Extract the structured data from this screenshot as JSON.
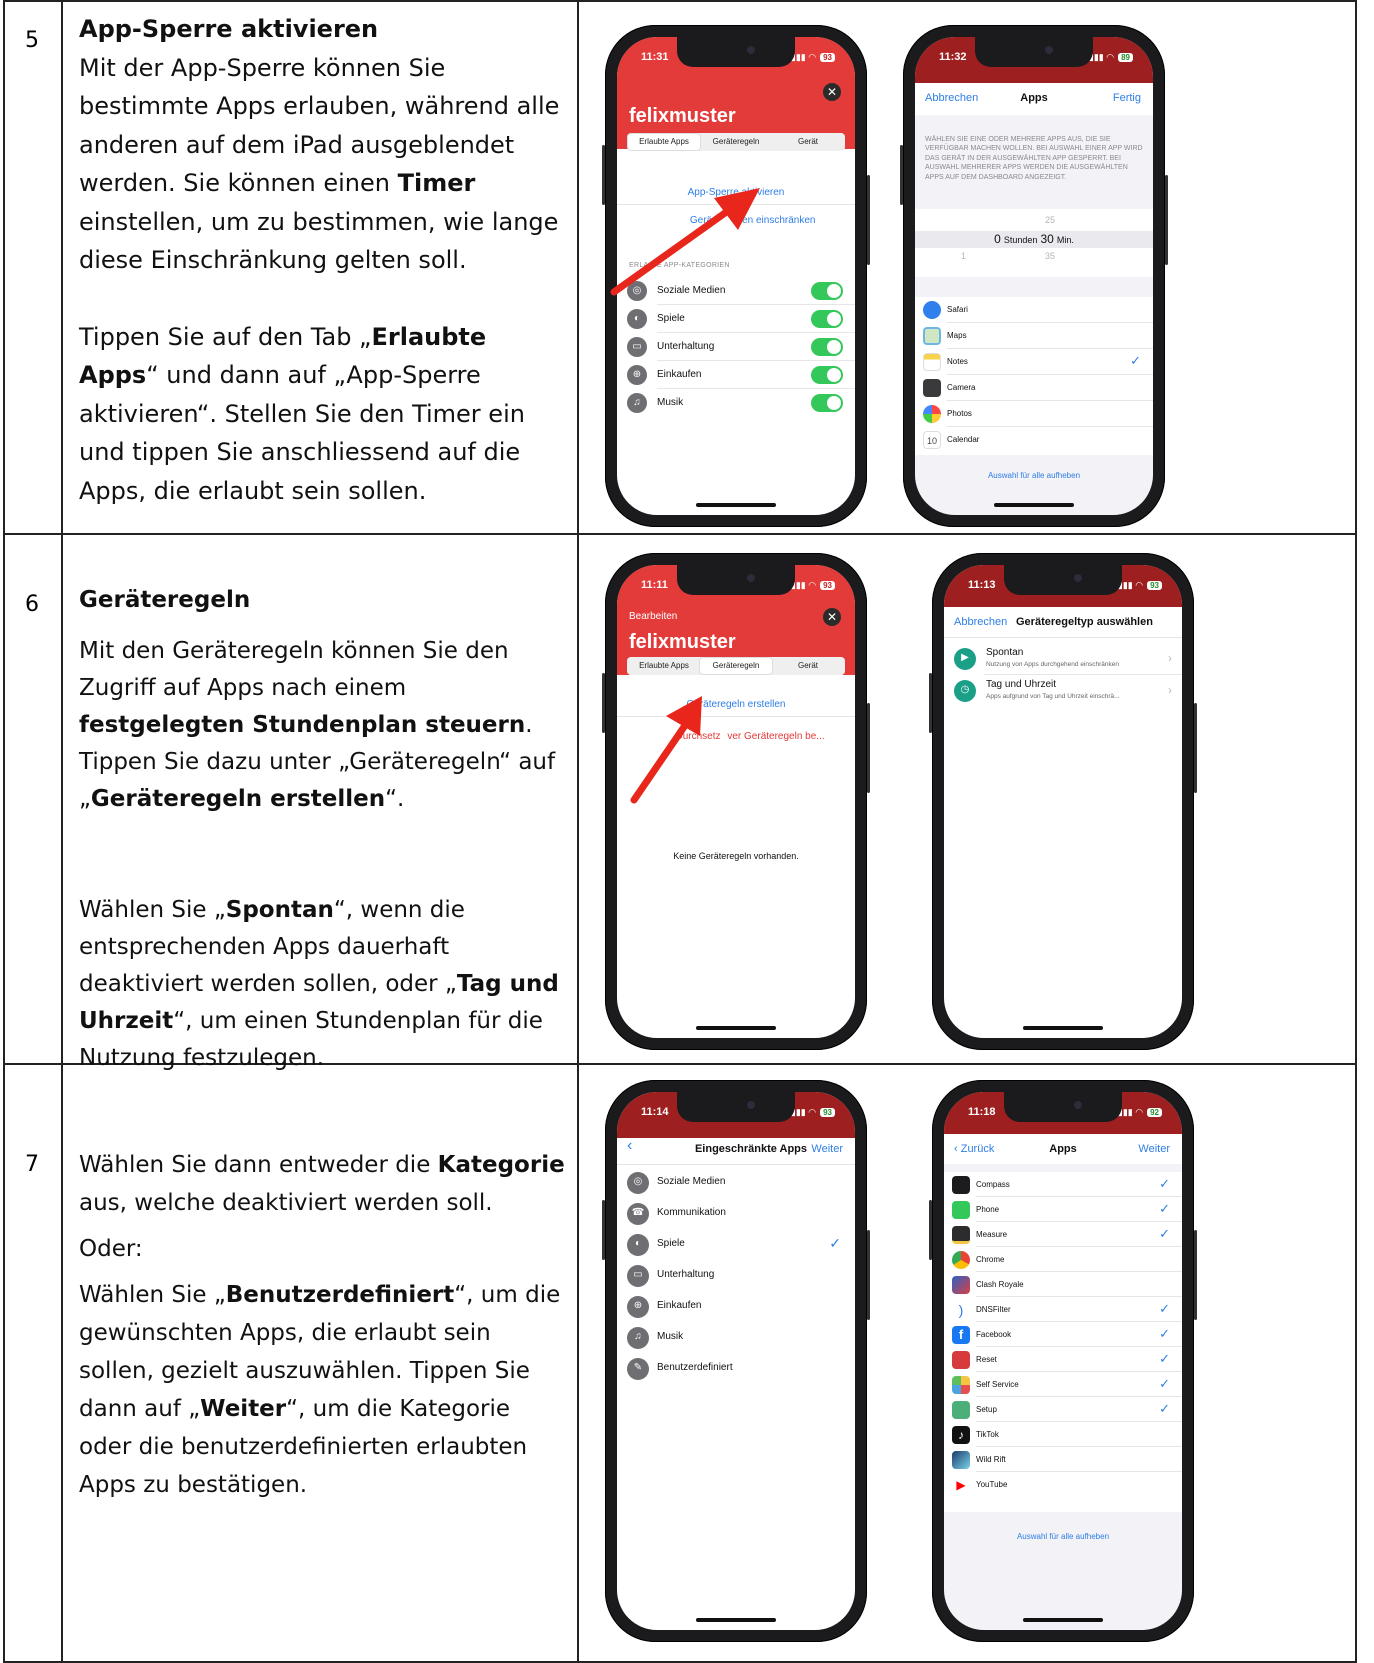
{
  "steps": [
    {
      "number": "5",
      "title": "App-Sperre aktivieren",
      "p1_a": "Mit der App-Sperre können Sie bestimmte Apps erlauben, während alle anderen auf dem iPad ausgeblendet werden. Sie können einen ",
      "p1_b": "Timer",
      "p1_c": " einstellen, um zu bestimmen, wie lange diese Einschränkung gelten soll.",
      "p2_a": "Tippen Sie auf den Tab „",
      "p2_b": "Erlaubte Apps",
      "p2_c": "“ und dann auf „App-Sperre aktivieren“. Stellen Sie den Timer ein und tippen Sie anschliessend auf die Apps, die erlaubt sein sollen."
    },
    {
      "number": "6",
      "title": "Geräteregeln",
      "p1_a": "Mit den Geräteregeln können Sie den Zugriff auf Apps nach einem ",
      "p1_b": "festgelegten Stundenplan steuern",
      "p1_c": ". Tippen Sie dazu unter „Geräteregeln“ auf „",
      "p1_d": "Geräteregeln erstellen",
      "p1_e": "“.",
      "p2_a": "Wählen Sie „",
      "p2_b": "Spontan",
      "p2_c": "“, wenn die entsprechenden Apps dauerhaft deaktiviert werden sollen, oder „",
      "p2_d": "Tag und Uhrzeit",
      "p2_e": "“, um einen Stundenplan für die Nutzung festzulegen."
    },
    {
      "number": "7",
      "p1_a": "Wählen Sie dann entweder die ",
      "p1_b": "Kategorie",
      "p1_c": " aus, welche deaktiviert werden soll.",
      "p2": "Oder:",
      "p3_a": "Wählen Sie „",
      "p3_b": "Benutzerdefiniert",
      "p3_c": "“, um die gewünschten Apps, die erlaubt sein sollen, gezielt auszuwählen. Tippen Sie dann auf „",
      "p3_d": "Weiter",
      "p3_e": "“, um die Kategorie oder die benutzerdefinierten erlaubten Apps zu bestätigen."
    }
  ],
  "colors": {
    "accent_red": "#e33a3a",
    "arrow_red": "#e8261c",
    "ios_blue": "#2e7ee6",
    "ios_green": "#34c759"
  },
  "phones": {
    "p5a": {
      "time": "11:31",
      "battery": "93",
      "user": "felixmuster",
      "tabs": [
        "Erlaubte Apps",
        "Geräteregeln",
        "Gerät"
      ],
      "link1": "App-Sperre aktivieren",
      "link2_left": "Gerä",
      "link2_right": "nen einschränken",
      "section_left": "ERLA",
      "section_right": "E APP-KATEGORIEN",
      "categories": [
        "Soziale Medien",
        "Spiele",
        "Unterhaltung",
        "Einkaufen",
        "Musik"
      ]
    },
    "p5b": {
      "time": "11:32",
      "battery": "89",
      "cancel": "Abbrechen",
      "title": "Apps",
      "done": "Fertig",
      "info": "WÄHLEN SIE EINE ODER MEHRERE APPS AUS, DIE SIE VERFÜGBAR MACHEN WOLLEN. BEI AUSWAHL EINER APP WIRD DAS GERÄT IN DER AUSGEWÄHLTEN APP GESPERRT. BEI AUSWAHL MEHRERER APPS WERDEN DIE AUSGEWÄHLTEN APPS AUF DEM DASHBOARD ANGEZEIGT.",
      "picker_above": "25",
      "picker_hours": "0",
      "picker_hours_label": "Stunden",
      "picker_minutes": "30",
      "picker_minutes_label": "Min.",
      "picker_below_left": "1",
      "picker_below_right": "35",
      "apps": [
        "Safari",
        "Maps",
        "Notes",
        "Camera",
        "Photos",
        "Calendar"
      ],
      "calendar_day": "10",
      "deselect": "Auswahl für alle aufheben"
    },
    "p6a": {
      "time": "11:11",
      "battery": "93",
      "edit": "Bearbeiten",
      "user": "felixmuster",
      "tabs": [
        "Erlaubte Apps",
        "Geräteregeln",
        "Gerät"
      ],
      "link1": "Geräteregeln erstellen",
      "link2_left": "Durchsetz",
      "link2_right": "ver Geräteregeln be...",
      "empty": "Keine Geräteregeln vorhanden."
    },
    "p6b": {
      "time": "11:13",
      "battery": "93",
      "cancel": "Abbrechen",
      "title": "Geräteregeltyp auswählen",
      "options": [
        {
          "title": "Spontan",
          "sub": "Nutzung von Apps durchgehend einschränken"
        },
        {
          "title": "Tag und Uhrzeit",
          "sub": "Apps aufgrund von Tag und Uhrzeit einschrä..."
        }
      ]
    },
    "p7a": {
      "time": "11:14",
      "battery": "93",
      "back": "‹",
      "title": "Eingeschränkte Apps",
      "next": "Weiter",
      "categories": [
        "Soziale Medien",
        "Kommunikation",
        "Spiele",
        "Unterhaltung",
        "Einkaufen",
        "Musik",
        "Benutzerdefiniert"
      ]
    },
    "p7b": {
      "time": "11:18",
      "battery": "92",
      "back": "‹ Zurück",
      "title": "Apps",
      "next": "Weiter",
      "apps": [
        "Compass",
        "Phone",
        "Measure",
        "Chrome",
        "Clash Royale",
        "DNSFilter",
        "Facebook",
        "Reset",
        "Self Service",
        "Setup",
        "TikTok",
        "Wild Rift",
        "YouTube"
      ],
      "deselect": "Auswahl für alle aufheben"
    }
  },
  "icons": {
    "close": "close-icon",
    "check": "checkmark-icon",
    "arrow": "red-arrow-annotation"
  }
}
